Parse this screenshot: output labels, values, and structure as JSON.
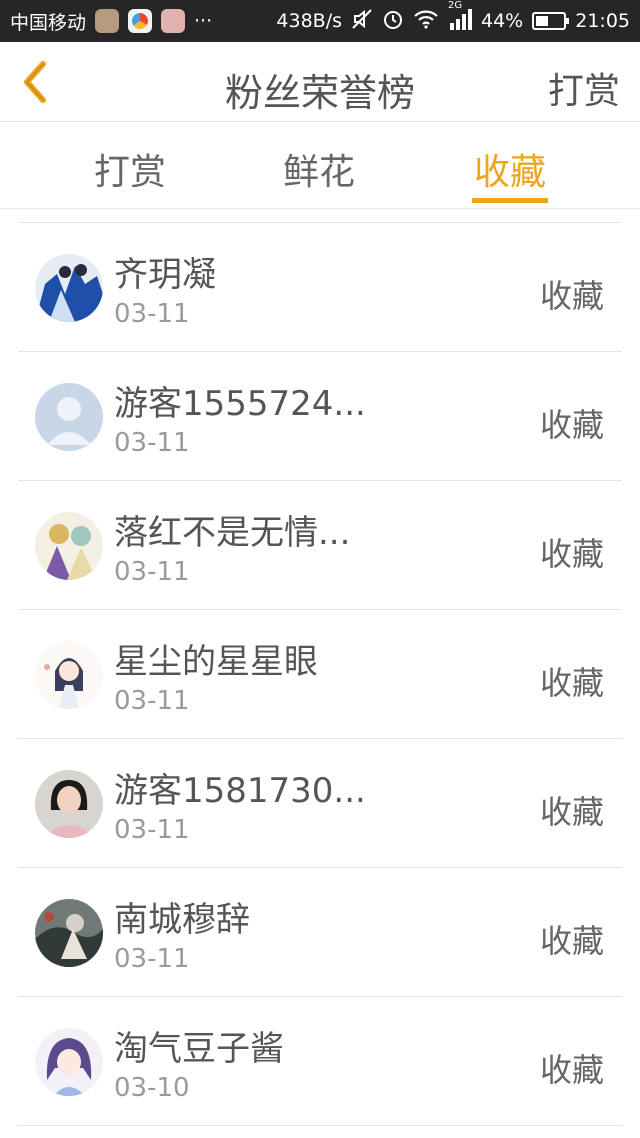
{
  "status_bar": {
    "carrier": "中国移动",
    "more": "···",
    "speed": "438B/s",
    "network": "2G",
    "battery": "44%",
    "battery_level": 0.44,
    "time": "21:05",
    "icons": [
      "app-icon-1",
      "app-icon-2",
      "app-icon-3",
      "mute-icon",
      "alarm-icon",
      "wifi-icon",
      "signal-icon",
      "battery-icon"
    ]
  },
  "nav": {
    "back_icon": "chevron-left-icon",
    "title": "粉丝荣誉榜",
    "action": "打赏"
  },
  "tabs": [
    {
      "label": "打赏",
      "active": false
    },
    {
      "label": "鲜花",
      "active": false
    },
    {
      "label": "收藏",
      "active": true
    }
  ],
  "accent_color": "#f0a31c",
  "list": [
    {
      "name": "齐玥凝",
      "date": "03-11",
      "type": "收藏"
    },
    {
      "name": "游客1555724...",
      "date": "03-11",
      "type": "收藏"
    },
    {
      "name": "落红不是无情...",
      "date": "03-11",
      "type": "收藏"
    },
    {
      "name": "星尘的星星眼",
      "date": "03-11",
      "type": "收藏"
    },
    {
      "name": "游客1581730...",
      "date": "03-11",
      "type": "收藏"
    },
    {
      "name": "南城穆辞",
      "date": "03-11",
      "type": "收藏"
    },
    {
      "name": "淘气豆子酱",
      "date": "03-10",
      "type": "收藏"
    }
  ]
}
